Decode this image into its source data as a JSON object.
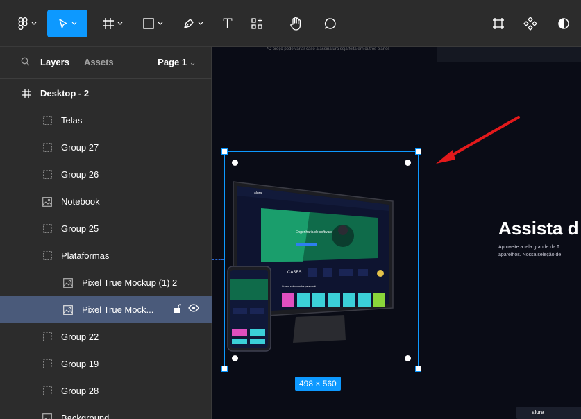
{
  "toolbar": {
    "tools": [
      {
        "name": "main-menu",
        "icon": "figma-logo-icon",
        "has_menu": true
      },
      {
        "name": "move",
        "icon": "cursor-arrow-icon",
        "has_menu": true,
        "active": true
      },
      {
        "name": "frame",
        "icon": "frame-hash-icon",
        "has_menu": true
      },
      {
        "name": "shape",
        "icon": "rectangle-icon",
        "has_menu": true
      },
      {
        "name": "pen",
        "icon": "pen-icon",
        "has_menu": true
      },
      {
        "name": "text",
        "icon": "text-icon",
        "label": "T"
      },
      {
        "name": "resources",
        "icon": "resources-icon"
      },
      {
        "name": "hand",
        "icon": "hand-icon"
      },
      {
        "name": "comment",
        "icon": "comment-icon"
      },
      {
        "name": "crop-frame",
        "icon": "crop-frame-icon"
      },
      {
        "name": "components",
        "icon": "components-icon"
      },
      {
        "name": "contrast",
        "icon": "contrast-icon"
      }
    ],
    "accent": "#0d99ff"
  },
  "panel": {
    "tabs": {
      "layers": "Layers",
      "assets": "Assets"
    },
    "page": "Page 1",
    "layers": [
      {
        "label": "Desktop - 2",
        "icon": "frame-hash-icon",
        "level": 0,
        "bold": true
      },
      {
        "label": "Telas",
        "icon": "group-icon",
        "level": 1
      },
      {
        "label": "Group 27",
        "icon": "group-icon",
        "level": 1
      },
      {
        "label": "Group 26",
        "icon": "group-icon",
        "level": 1
      },
      {
        "label": "Notebook",
        "icon": "image-icon",
        "level": 1
      },
      {
        "label": "Group 25",
        "icon": "group-icon",
        "level": 1
      },
      {
        "label": "Plataformas",
        "icon": "group-icon",
        "level": 1
      },
      {
        "label": "Pixel True Mockup (1) 2",
        "icon": "image-icon",
        "level": 2
      },
      {
        "label": "Pixel True Mock...",
        "icon": "image-icon",
        "level": 2,
        "selected": true
      },
      {
        "label": "Group 22",
        "icon": "group-icon",
        "level": 1
      },
      {
        "label": "Group 19",
        "icon": "group-icon",
        "level": 1
      },
      {
        "label": "Group 28",
        "icon": "group-icon",
        "level": 1
      },
      {
        "label": "Background",
        "icon": "image-icon",
        "level": 1
      }
    ]
  },
  "canvas": {
    "top_note": "*O preço pode variar caso a assinatura seja feita em outros planos",
    "hero_title": "Assista d",
    "hero_text_1": "Aproveite a tela grande da T",
    "hero_text_2": "aparelhos. Nossa seleção de",
    "selection_size": "498 × 560",
    "footer_logo": "alura",
    "mockup": {
      "logo": "alura",
      "banner_title": "Engenharia de software",
      "cases_label": "CASES",
      "section_title": "Cursos selecionados para você"
    }
  }
}
